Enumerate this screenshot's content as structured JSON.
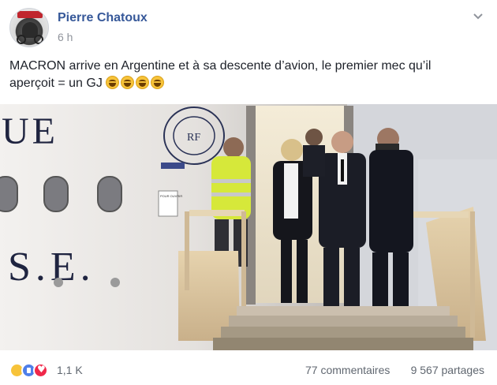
{
  "post": {
    "author": "Pierre Chatoux",
    "time": "6 h",
    "text_line1": "MACRON arrive en Argentine et à sa descente d’avion, le premier mec qu’il",
    "text_line2": "aperçoit = un GJ",
    "emoji_count": 4,
    "emoji": "laughing-tears-emoji"
  },
  "photo": {
    "plane_lettering_top": "UE",
    "plane_lettering_bottom": "S.E.",
    "seal_initials": "RF",
    "door_sign": "POUR OUVRIR"
  },
  "footer": {
    "reaction_count": "1,1 K",
    "comments": "77 commentaires",
    "shares": "9 567 partages"
  },
  "colors": {
    "author_blue": "#365899",
    "meta_grey": "#90949c",
    "text": "#1d2129",
    "vest_yellow": "#d6e83a",
    "like_blue": "#4f7fe9",
    "love_red": "#f0284a"
  }
}
